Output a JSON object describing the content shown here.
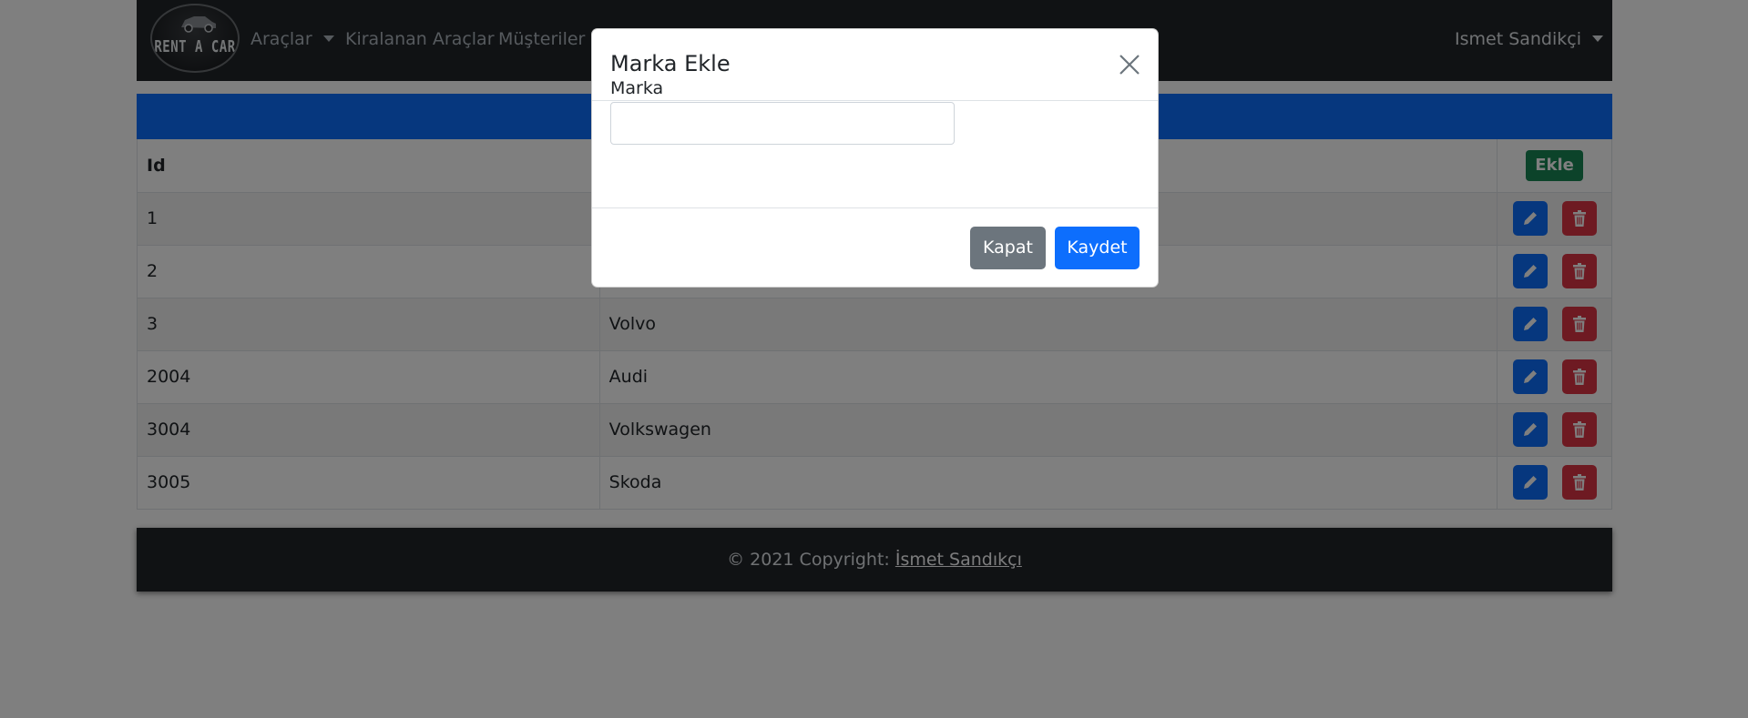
{
  "navbar": {
    "logo_text": "RENT A CAR",
    "menu": {
      "araclar": "Araçlar",
      "kiralanan": "Kiralanan Araçlar",
      "musteriler": "Müşteriler"
    },
    "user_name": "Ismet Sandikçi"
  },
  "table": {
    "headers": {
      "id": "Id",
      "add_button": "Ekle"
    },
    "rows": [
      {
        "id": "1",
        "name": ""
      },
      {
        "id": "2",
        "name": ""
      },
      {
        "id": "3",
        "name": "Volvo"
      },
      {
        "id": "2004",
        "name": "Audi"
      },
      {
        "id": "3004",
        "name": "Volkswagen"
      },
      {
        "id": "3005",
        "name": "Skoda"
      }
    ]
  },
  "footer": {
    "copyright": "© 2021 Copyright: ",
    "author_link": "İsmet Sandıkçı"
  },
  "modal": {
    "title": "Marka Ekle",
    "field_label": "Marka",
    "field_value": "",
    "close_button": "Kapat",
    "save_button": "Kaydet"
  },
  "colors": {
    "primary": "#0d6efd",
    "success": "#198754",
    "danger": "#dc3545",
    "secondary": "#6c757d",
    "dark": "#212529"
  },
  "icons": {
    "edit": "pencil-icon",
    "delete": "trash-icon",
    "close": "close-icon",
    "dropdown": "caret-down-icon"
  }
}
